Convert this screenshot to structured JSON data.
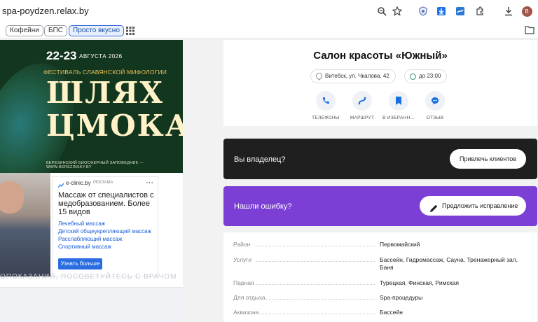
{
  "browser": {
    "url": "spa-poydzen.relax.by",
    "avatar_letter": "B",
    "bookmarks": [
      "Кофейни",
      "БПС",
      "Просто вкусно"
    ]
  },
  "banner": {
    "date": "22-23",
    "month_year": "АВГУСТА 2026",
    "festival": "ФЕСТИВАЛЬ СЛАВЯНСКОЙ МИФОЛОГИИ",
    "title_line1": "ШЛЯХ",
    "title_line2": "ЦМОКА",
    "reserve": "БЕРЕЗИНСКИЙ БИОСФЕРНЫЙ ЗАПОВЕДНИК — WWW.BEREZINSKY.BY"
  },
  "ad": {
    "source": "e-clinic.by",
    "tag": "РЕКЛАМА",
    "headline": "Массаж от специалистов с медобразованием. Более 15 видов",
    "links": [
      "Лечебный массаж",
      "Детский общеукрепляющий массаж",
      "Расслабляющий массаж",
      "Спортивный массаж"
    ],
    "button": "Узнать больше",
    "disclaimer": "ОПОКАЗАНИЯ, ПОСОВЕТУЙТЕСЬ С ВРАЧОМ"
  },
  "salon": {
    "title": "Салон красоты «Южный»",
    "address": "Витебск, ул. Чкалова, 42",
    "hours": "до 23:00",
    "actions": [
      "ТЕЛЕФОНЫ",
      "МАРШРУТ",
      "В ИЗБРАНН...",
      "ОТЗЫВ"
    ]
  },
  "owner": {
    "text": "Вы владелец?",
    "button": "Привлечь клиентов"
  },
  "error": {
    "text": "Нашли ошибку?",
    "button": "Предложить исправление"
  },
  "details": [
    {
      "key": "Район",
      "value": "Первомайский"
    },
    {
      "key": "Услуги",
      "value": "Бассейн, Гидромассаж, Сауна, Тренажерный зал, Баня"
    },
    {
      "key": "Парная",
      "value": "Турецкая, Финская, Римская"
    },
    {
      "key": "Для отдыха",
      "value": "Spa-процедуры"
    },
    {
      "key": "Аквазона",
      "value": "Бассейн"
    }
  ],
  "colors": {
    "accent_blue": "#2a6de0",
    "owner_bg": "#1f1f1f",
    "error_bg": "#7b3fd6",
    "action_icon": "#1a6fe0"
  }
}
